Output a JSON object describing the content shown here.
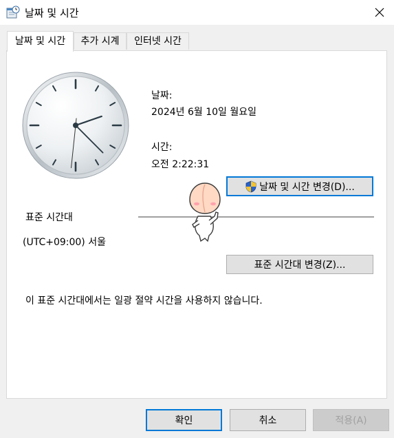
{
  "window": {
    "title": "날짜 및 시간",
    "icon": "date-time-icon",
    "close_icon": "close-icon"
  },
  "tabs": [
    {
      "label": "날짜 및 시간",
      "active": true
    },
    {
      "label": "추가 시계",
      "active": false
    },
    {
      "label": "인터넷 시간",
      "active": false
    }
  ],
  "datetime": {
    "date_label": "날짜:",
    "date_value": "2024년 6월 10일 월요일",
    "time_label": "시간:",
    "time_value": "오전 2:22:31",
    "change_button": "날짜 및 시간 변경(D)...",
    "shield_icon": "uac-shield-icon"
  },
  "timezone": {
    "section_label": "표준 시간대",
    "value": "(UTC+09:00) 서울",
    "change_button": "표준 시간대 변경(Z)...",
    "dst_note": "이 표준 시간대에서는 일광 절약 시간을 사용하지 않습니다."
  },
  "clock": {
    "hour": 2,
    "minute": 22,
    "second": 31
  },
  "footer": {
    "ok": "확인",
    "cancel": "취소",
    "apply": "적용(A)"
  },
  "colors": {
    "accent": "#0078d7",
    "clock_hand": "#2b3a44",
    "clock_second": "#333333"
  }
}
